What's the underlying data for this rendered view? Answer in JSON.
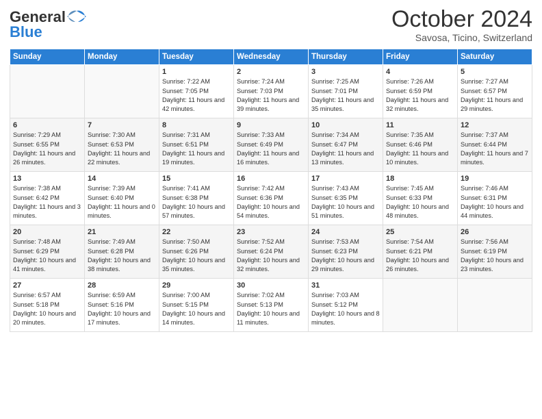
{
  "header": {
    "logo_general": "General",
    "logo_blue": "Blue",
    "month_title": "October 2024",
    "location": "Savosa, Ticino, Switzerland"
  },
  "days_of_week": [
    "Sunday",
    "Monday",
    "Tuesday",
    "Wednesday",
    "Thursday",
    "Friday",
    "Saturday"
  ],
  "weeks": [
    [
      {
        "day": "",
        "info": ""
      },
      {
        "day": "",
        "info": ""
      },
      {
        "day": "1",
        "info": "Sunrise: 7:22 AM\nSunset: 7:05 PM\nDaylight: 11 hours and 42 minutes."
      },
      {
        "day": "2",
        "info": "Sunrise: 7:24 AM\nSunset: 7:03 PM\nDaylight: 11 hours and 39 minutes."
      },
      {
        "day": "3",
        "info": "Sunrise: 7:25 AM\nSunset: 7:01 PM\nDaylight: 11 hours and 35 minutes."
      },
      {
        "day": "4",
        "info": "Sunrise: 7:26 AM\nSunset: 6:59 PM\nDaylight: 11 hours and 32 minutes."
      },
      {
        "day": "5",
        "info": "Sunrise: 7:27 AM\nSunset: 6:57 PM\nDaylight: 11 hours and 29 minutes."
      }
    ],
    [
      {
        "day": "6",
        "info": "Sunrise: 7:29 AM\nSunset: 6:55 PM\nDaylight: 11 hours and 26 minutes."
      },
      {
        "day": "7",
        "info": "Sunrise: 7:30 AM\nSunset: 6:53 PM\nDaylight: 11 hours and 22 minutes."
      },
      {
        "day": "8",
        "info": "Sunrise: 7:31 AM\nSunset: 6:51 PM\nDaylight: 11 hours and 19 minutes."
      },
      {
        "day": "9",
        "info": "Sunrise: 7:33 AM\nSunset: 6:49 PM\nDaylight: 11 hours and 16 minutes."
      },
      {
        "day": "10",
        "info": "Sunrise: 7:34 AM\nSunset: 6:47 PM\nDaylight: 11 hours and 13 minutes."
      },
      {
        "day": "11",
        "info": "Sunrise: 7:35 AM\nSunset: 6:46 PM\nDaylight: 11 hours and 10 minutes."
      },
      {
        "day": "12",
        "info": "Sunrise: 7:37 AM\nSunset: 6:44 PM\nDaylight: 11 hours and 7 minutes."
      }
    ],
    [
      {
        "day": "13",
        "info": "Sunrise: 7:38 AM\nSunset: 6:42 PM\nDaylight: 11 hours and 3 minutes."
      },
      {
        "day": "14",
        "info": "Sunrise: 7:39 AM\nSunset: 6:40 PM\nDaylight: 11 hours and 0 minutes."
      },
      {
        "day": "15",
        "info": "Sunrise: 7:41 AM\nSunset: 6:38 PM\nDaylight: 10 hours and 57 minutes."
      },
      {
        "day": "16",
        "info": "Sunrise: 7:42 AM\nSunset: 6:36 PM\nDaylight: 10 hours and 54 minutes."
      },
      {
        "day": "17",
        "info": "Sunrise: 7:43 AM\nSunset: 6:35 PM\nDaylight: 10 hours and 51 minutes."
      },
      {
        "day": "18",
        "info": "Sunrise: 7:45 AM\nSunset: 6:33 PM\nDaylight: 10 hours and 48 minutes."
      },
      {
        "day": "19",
        "info": "Sunrise: 7:46 AM\nSunset: 6:31 PM\nDaylight: 10 hours and 44 minutes."
      }
    ],
    [
      {
        "day": "20",
        "info": "Sunrise: 7:48 AM\nSunset: 6:29 PM\nDaylight: 10 hours and 41 minutes."
      },
      {
        "day": "21",
        "info": "Sunrise: 7:49 AM\nSunset: 6:28 PM\nDaylight: 10 hours and 38 minutes."
      },
      {
        "day": "22",
        "info": "Sunrise: 7:50 AM\nSunset: 6:26 PM\nDaylight: 10 hours and 35 minutes."
      },
      {
        "day": "23",
        "info": "Sunrise: 7:52 AM\nSunset: 6:24 PM\nDaylight: 10 hours and 32 minutes."
      },
      {
        "day": "24",
        "info": "Sunrise: 7:53 AM\nSunset: 6:23 PM\nDaylight: 10 hours and 29 minutes."
      },
      {
        "day": "25",
        "info": "Sunrise: 7:54 AM\nSunset: 6:21 PM\nDaylight: 10 hours and 26 minutes."
      },
      {
        "day": "26",
        "info": "Sunrise: 7:56 AM\nSunset: 6:19 PM\nDaylight: 10 hours and 23 minutes."
      }
    ],
    [
      {
        "day": "27",
        "info": "Sunrise: 6:57 AM\nSunset: 5:18 PM\nDaylight: 10 hours and 20 minutes."
      },
      {
        "day": "28",
        "info": "Sunrise: 6:59 AM\nSunset: 5:16 PM\nDaylight: 10 hours and 17 minutes."
      },
      {
        "day": "29",
        "info": "Sunrise: 7:00 AM\nSunset: 5:15 PM\nDaylight: 10 hours and 14 minutes."
      },
      {
        "day": "30",
        "info": "Sunrise: 7:02 AM\nSunset: 5:13 PM\nDaylight: 10 hours and 11 minutes."
      },
      {
        "day": "31",
        "info": "Sunrise: 7:03 AM\nSunset: 5:12 PM\nDaylight: 10 hours and 8 minutes."
      },
      {
        "day": "",
        "info": ""
      },
      {
        "day": "",
        "info": ""
      }
    ]
  ]
}
